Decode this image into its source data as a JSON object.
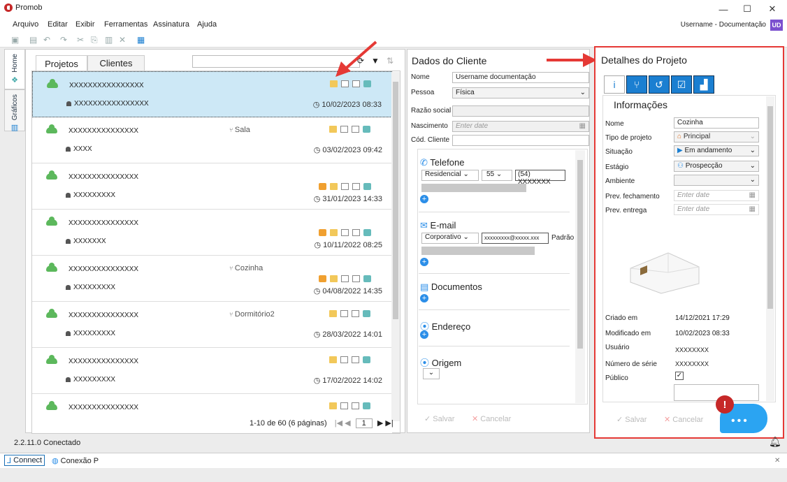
{
  "window": {
    "title": "Promob",
    "minimize": "—",
    "maximize": "☐",
    "close": "✕"
  },
  "menu": [
    "Arquivo",
    "Editar",
    "Exibir",
    "Ferramentas",
    "Assinatura",
    "Ajuda"
  ],
  "user": {
    "name": "Username - Documentação",
    "initials": "UD"
  },
  "sidebar": {
    "home": "Home",
    "graficos": "Gráficos"
  },
  "projects_panel": {
    "tabs": [
      "Projetos",
      "Clientes"
    ],
    "rows": [
      {
        "name": "XXXXXXXXXXXXXXXX",
        "user": "XXXXXXXXXXXXXXXX",
        "room": "",
        "date": "10/02/2023 08:33",
        "person_icon": false
      },
      {
        "name": "XXXXXXXXXXXXXXX",
        "user": "XXXX",
        "room": "Sala",
        "date": "03/02/2023 09:42",
        "person_icon": false
      },
      {
        "name": "XXXXXXXXXXXXXXX",
        "user": "XXXXXXXXX",
        "room": "",
        "date": "31/01/2023 14:33",
        "person_icon": true
      },
      {
        "name": "XXXXXXXXXXXXXXX",
        "user": "XXXXXXX",
        "room": "",
        "date": "10/11/2022 08:25",
        "person_icon": true
      },
      {
        "name": "XXXXXXXXXXXXXXX",
        "user": "XXXXXXXXX",
        "room": "Cozinha",
        "date": "04/08/2022 14:35",
        "person_icon": true
      },
      {
        "name": "XXXXXXXXXXXXXXX",
        "user": "XXXXXXXXX",
        "room": "Dormitório2",
        "date": "28/03/2022 14:01",
        "person_icon": false
      },
      {
        "name": "XXXXXXXXXXXXXXX",
        "user": "XXXXXXXXX",
        "room": "",
        "date": "17/02/2022 14:02",
        "person_icon": false
      },
      {
        "name": "XXXXXXXXXXXXXXX",
        "user": "",
        "room": "",
        "date": "",
        "person_icon": false
      }
    ],
    "pager": "1-10 de 60 (6 páginas)",
    "page": "1"
  },
  "client_panel": {
    "title": "Dados do Cliente",
    "nome_label": "Nome",
    "nome": "Username documentação",
    "pessoa_label": "Pessoa",
    "pessoa": "Física",
    "razao_label": "Razão social",
    "nascimento_label": "Nascimento",
    "nascimento_placeholder": "Enter date",
    "cod_label": "Cód. Cliente",
    "telefone": "Telefone",
    "tel_tipo": "Residencial",
    "tel_ddi": "55",
    "tel_num": "(54) XXXXXXX",
    "email": "E-mail",
    "email_tipo": "Corporativo",
    "email_val": "xxxxxxxxx@xxxxx.xxx",
    "email_padrao": "Padrão",
    "documentos": "Documentos",
    "endereco": "Endereço",
    "origem": "Origem",
    "salvar": "Salvar",
    "cancelar": "Cancelar"
  },
  "details_panel": {
    "title": "Detalhes do Projeto",
    "info": "Informações",
    "nome_label": "Nome",
    "nome": "Cozinha",
    "tipo_label": "Tipo de projeto",
    "tipo": "Principal",
    "situacao_label": "Situação",
    "situacao": "Em andamento",
    "estagio_label": "Estágio",
    "estagio": "Prospecção",
    "ambiente_label": "Ambiente",
    "prev_fech_label": "Prev. fechamento",
    "prev_fech": "Enter date",
    "prev_ent_label": "Prev. entrega",
    "prev_ent": "Enter date",
    "criado_label": "Criado em",
    "criado": "14/12/2021 17:29",
    "modificado_label": "Modificado em",
    "modificado": "10/02/2023 08:33",
    "usuario_label": "Usuário",
    "usuario": "XXXXXXXX",
    "serie_label": "Número de série",
    "serie": "XXXXXXXX",
    "publico_label": "Público",
    "salvar": "Salvar",
    "cancelar": "Cancelar"
  },
  "status": {
    "version": "2.2.11.0 Conectado",
    "connect": "Connect",
    "conexao": "Conexão P"
  },
  "colors": {
    "accent": "#1b7fd1",
    "highlight_border": "#e53935",
    "selected_row": "#cde8f6"
  }
}
